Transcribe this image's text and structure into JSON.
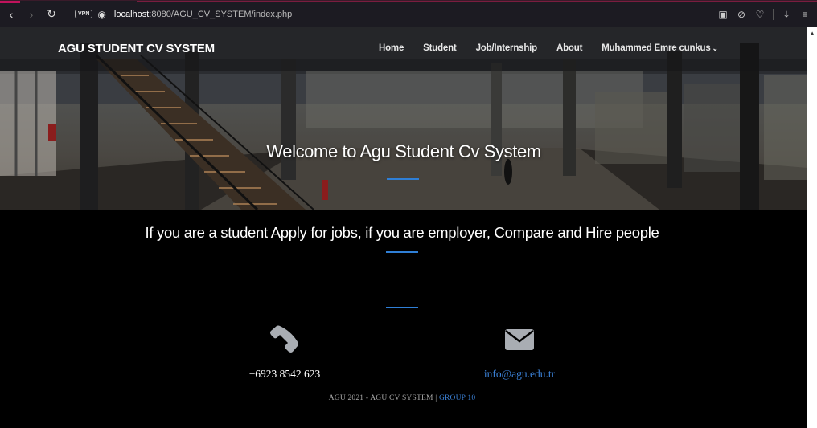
{
  "browser": {
    "vpn_label": "VPN",
    "url_host": "localhost",
    "url_rest": ":8080/AGU_CV_SYSTEM/index.php"
  },
  "nav": {
    "brand": "AGU STUDENT CV SYSTEM",
    "items": [
      {
        "label": "Home"
      },
      {
        "label": "Student"
      },
      {
        "label": "Job/Internship"
      },
      {
        "label": "About"
      }
    ],
    "user": "Muhammed Emre cunkus"
  },
  "hero": {
    "title": "Welcome to Agu Student Cv System"
  },
  "main": {
    "tagline": "If you are a student Apply for jobs, if you are employer, Compare and Hire people"
  },
  "contact": {
    "phone": "+6923 8542 623",
    "email": "info@agu.edu.tr"
  },
  "footer": {
    "text": "AGU 2021 - AGU CV SYSTEM | ",
    "group": "GROUP 10"
  },
  "colors": {
    "accent": "#2f7fd6",
    "link": "#3b82d8",
    "background": "#000000"
  }
}
